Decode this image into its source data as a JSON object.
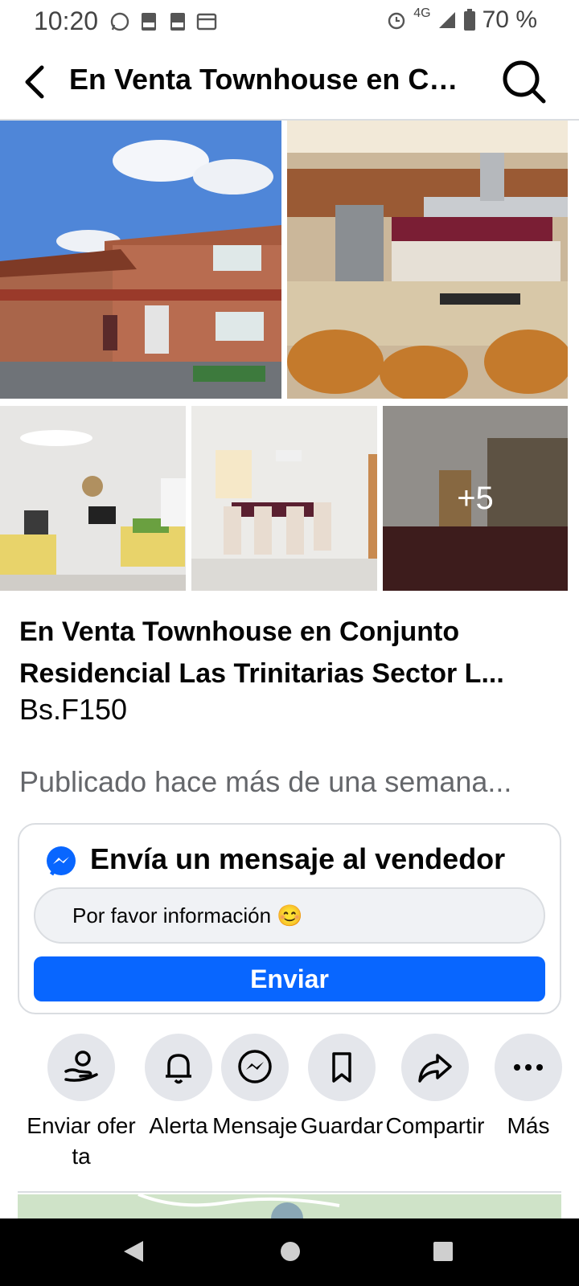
{
  "status_bar": {
    "time": "10:20",
    "battery": "70 %",
    "network": "4G"
  },
  "app_bar": {
    "title": "En Venta Townhouse en Conjunto Residencial Las Trinitarias Sector L..."
  },
  "photos": {
    "more_count": "+5"
  },
  "listing": {
    "title_line1": "En Venta Townhouse en Conjunto",
    "title_line2": "Residencial Las Trinitarias Sector L...",
    "price": "Bs.F150",
    "posted": "Publicado hace más de una semana..."
  },
  "message_card": {
    "title": "Envía un mensaje al vendedor",
    "message_value": "Por favor información 😊",
    "send_label": "Enviar"
  },
  "actions": [
    {
      "label": "Enviar oferta",
      "icon": "offer-icon"
    },
    {
      "label": "Alerta",
      "icon": "bell-icon"
    },
    {
      "label": "Mensaje",
      "icon": "messenger-icon"
    },
    {
      "label": "Guardar",
      "icon": "bookmark-icon"
    },
    {
      "label": "Compartir",
      "icon": "share-icon"
    },
    {
      "label": "Más",
      "icon": "more-icon"
    }
  ],
  "colors": {
    "accent": "#0866ff",
    "icon_bg": "#e4e6eb",
    "muted_text": "#65676b"
  }
}
